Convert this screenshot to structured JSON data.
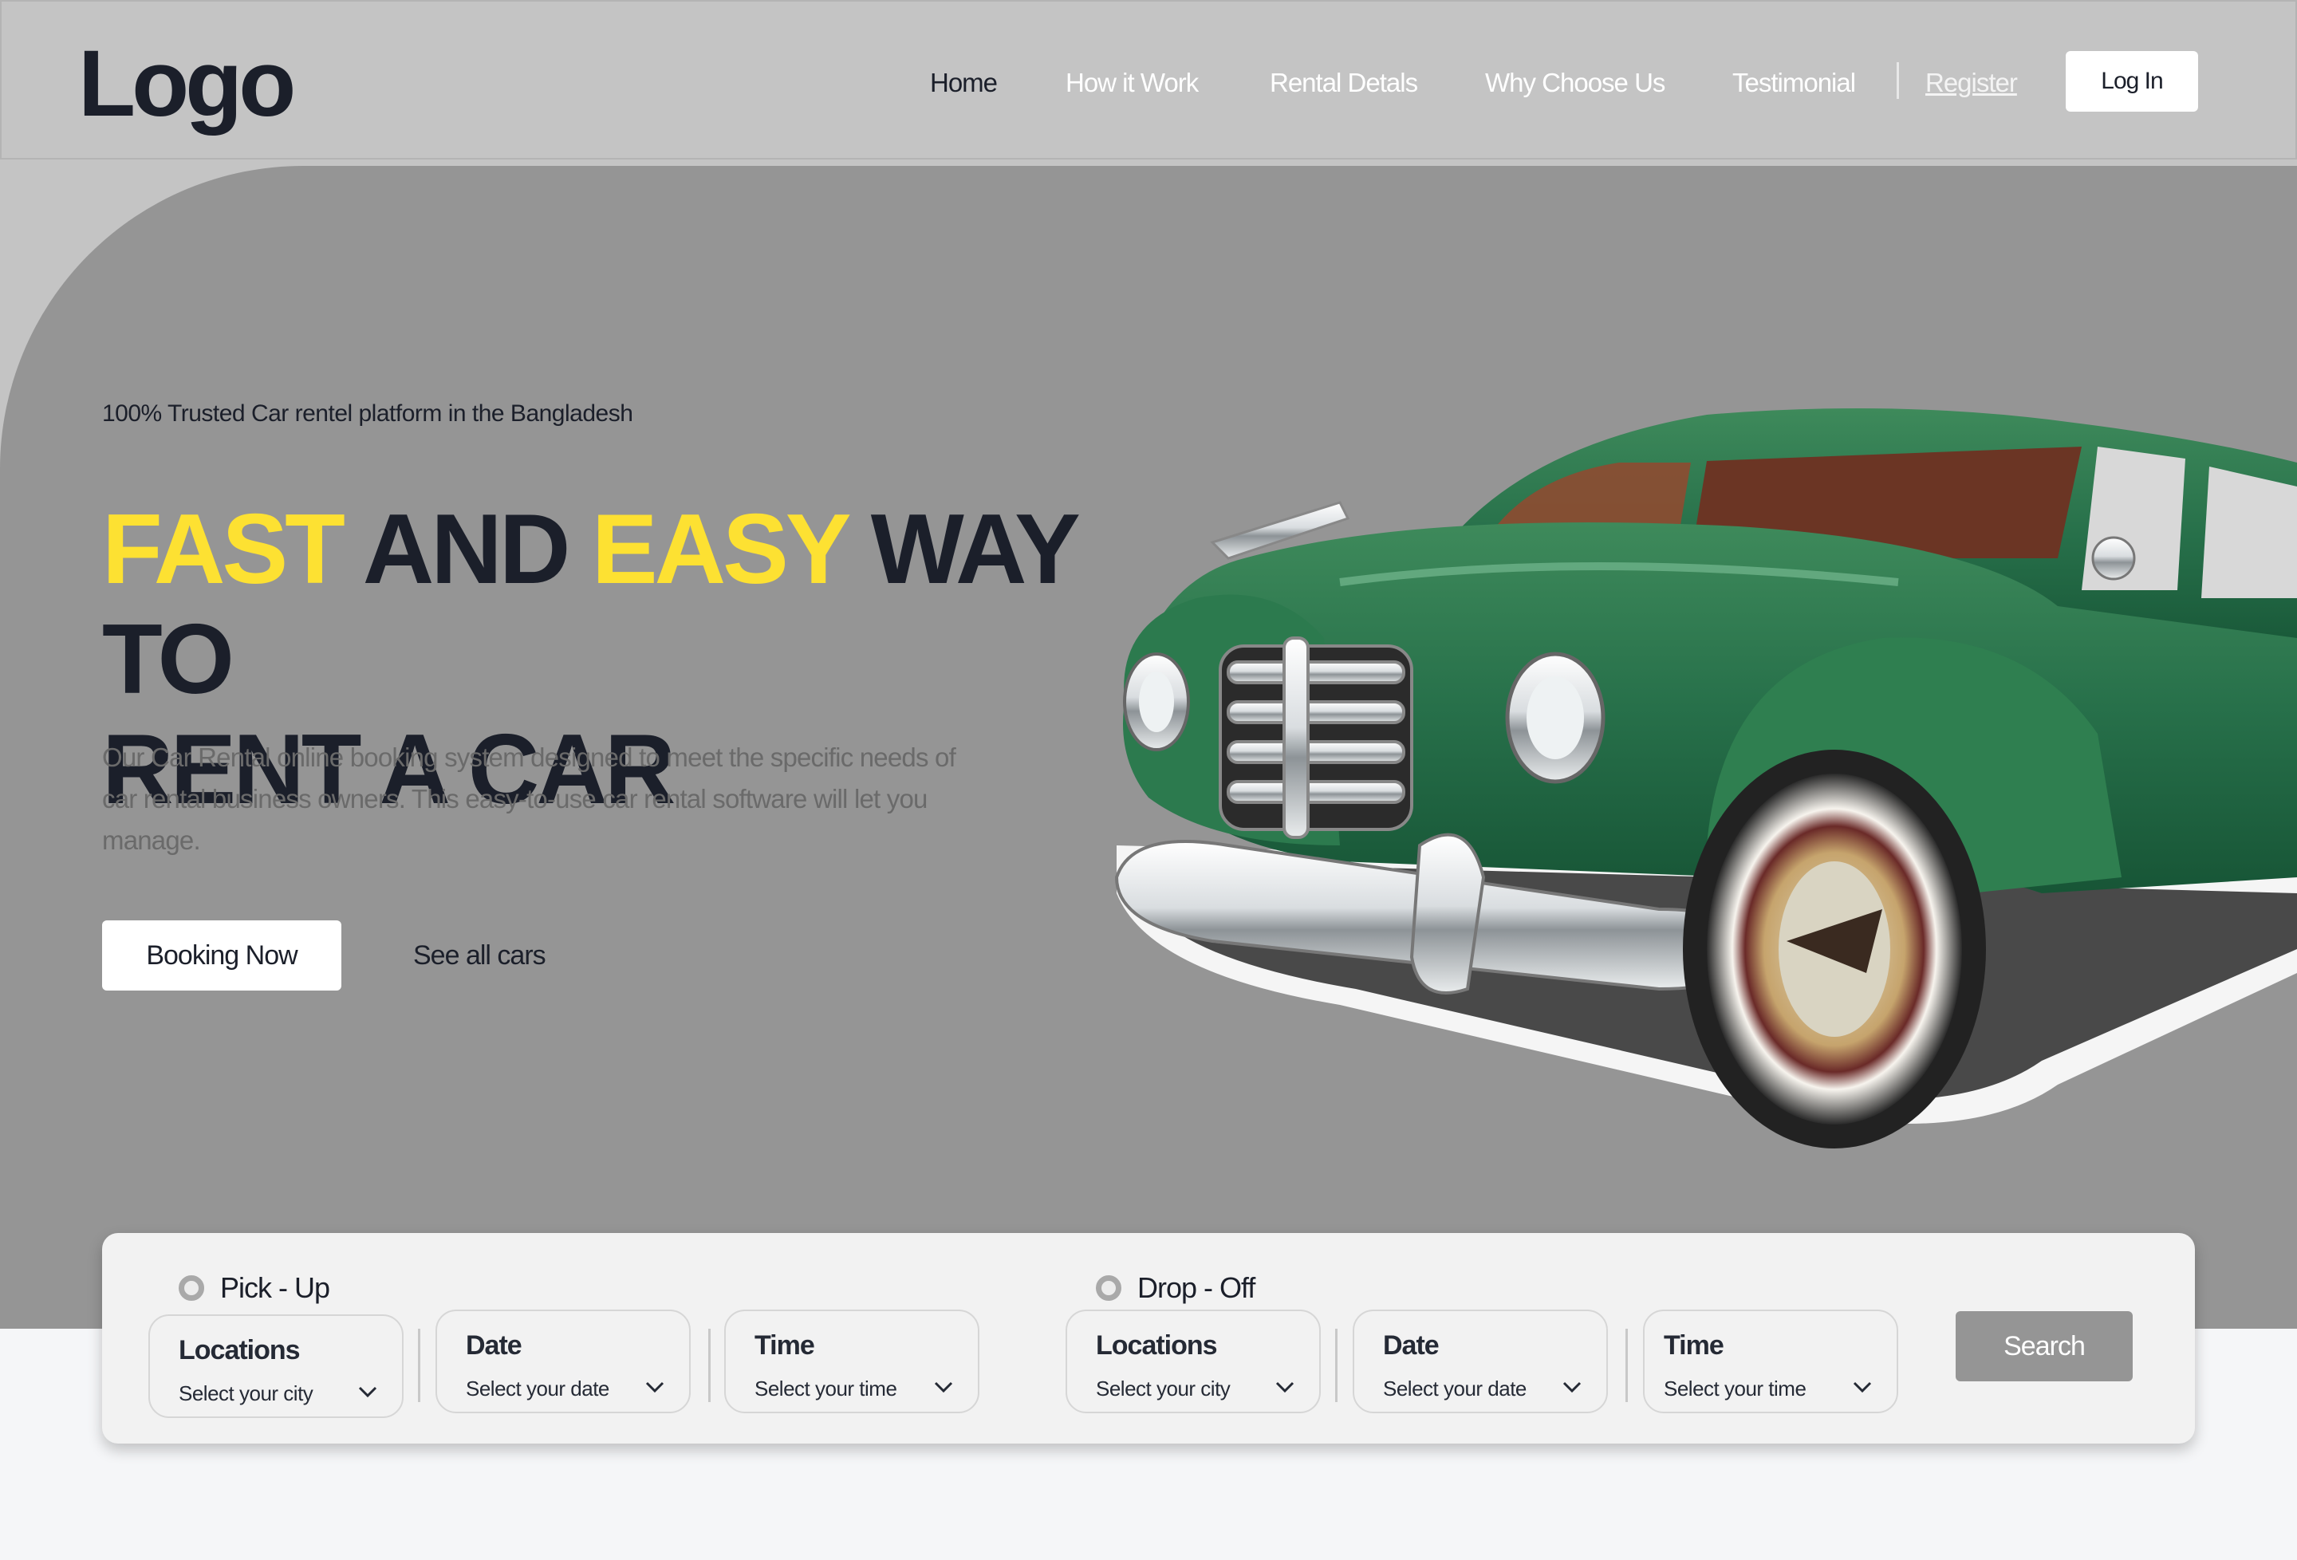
{
  "header": {
    "logo": "Logo",
    "nav": [
      {
        "label": "Home",
        "active": true
      },
      {
        "label": "How it Work",
        "active": false
      },
      {
        "label": "Rental Detals",
        "active": false
      },
      {
        "label": "Why Choose Us",
        "active": false
      },
      {
        "label": "Testimonial",
        "active": false
      }
    ],
    "register": "Register",
    "login": "Log In"
  },
  "hero": {
    "tagline": "100% Trusted Car rentel platform in the Bangladesh",
    "headline": {
      "w1": "FAST",
      "w2": " AND ",
      "w3": "EASY",
      "w4": " WAY TO",
      "line2": "RENT A CAR"
    },
    "description": "Our Car Rental  online booking system designed to meet the specific needs of car rental business owners. This easy-to-use car rental software will let you manage.",
    "primary_button": "Booking Now",
    "secondary_link": "See all cars",
    "image": "vintage-green-car"
  },
  "search": {
    "pickup": {
      "label": "Pick - Up",
      "fields": [
        {
          "title": "Locations",
          "value": "Select your city"
        },
        {
          "title": "Date",
          "value": "Select your date"
        },
        {
          "title": "Time",
          "value": "Select your time"
        }
      ]
    },
    "dropoff": {
      "label": "Drop - Off",
      "fields": [
        {
          "title": "Locations",
          "value": "Select your city"
        },
        {
          "title": "Date",
          "value": "Select your date"
        },
        {
          "title": "Time",
          "value": "Select your time"
        }
      ]
    },
    "button": "Search"
  },
  "colors": {
    "accent_yellow": "#fde132",
    "dark_text": "#1b1f2a",
    "hero_bg": "#959595",
    "header_bg": "#c4c4c4"
  }
}
